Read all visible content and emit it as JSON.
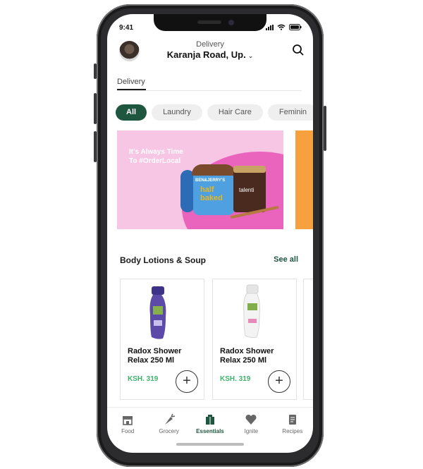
{
  "status": {
    "time": "9:41"
  },
  "header": {
    "subtitle": "Delivery",
    "location": "Karanja Road, Up.",
    "chevron_icon": "chevron-down-icon",
    "search_icon": "search-icon"
  },
  "tabs": [
    {
      "label": "Delivery",
      "active": true
    }
  ],
  "chips": [
    {
      "label": "All",
      "active": true
    },
    {
      "label": "Laundry",
      "active": false
    },
    {
      "label": "Hair Care",
      "active": false
    },
    {
      "label": "Feminin",
      "active": false
    }
  ],
  "banner": {
    "line1": "It's Always Time",
    "line2": "To #OrderLocal",
    "brand1": "BEN&JERRY'S",
    "product1": "half baked",
    "brand2": "talenti"
  },
  "section": {
    "title": "Body Lotions & Soup",
    "see_all": "See all"
  },
  "products": [
    {
      "name": "Radox Shower Relax 250 Ml",
      "price": "KSH. 319",
      "color": "#5b4aa8"
    },
    {
      "name": "Radox Shower Relax 250 Ml",
      "price": "KSH. 319",
      "color": "#f2f2f2"
    }
  ],
  "nav": [
    {
      "label": "Food",
      "icon": "food-icon",
      "active": false
    },
    {
      "label": "Grocery",
      "icon": "carrot-icon",
      "active": false
    },
    {
      "label": "Essentials",
      "icon": "essentials-icon",
      "active": true
    },
    {
      "label": "Ignite",
      "icon": "heart-icon",
      "active": false
    },
    {
      "label": "Recipes",
      "icon": "recipes-icon",
      "active": false
    }
  ],
  "colors": {
    "brand": "#1e5640",
    "price": "#3cb46c",
    "banner_bg": "#f7c6e5",
    "banner_blob": "#ea64be",
    "next_banner": "#f7a13e"
  }
}
